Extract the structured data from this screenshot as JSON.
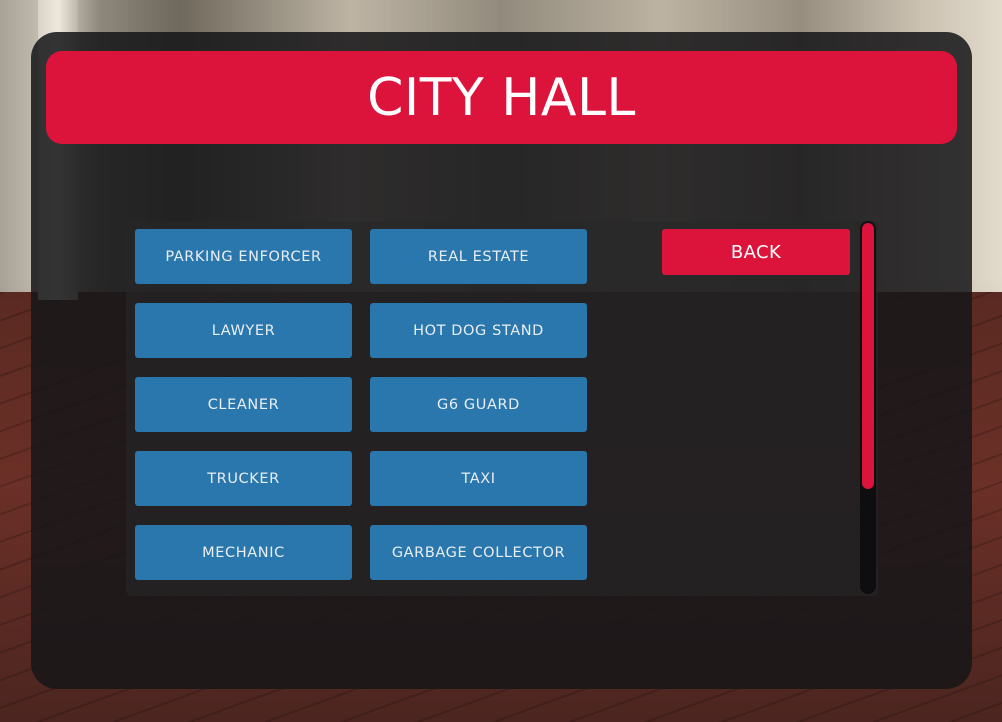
{
  "header": {
    "title": "CITY HALL"
  },
  "jobs": [
    "PARKING ENFORCER",
    "REAL ESTATE",
    "LAWYER",
    "HOT DOG STAND",
    "CLEANER",
    "G6 GUARD",
    "TRUCKER",
    "TAXI",
    "MECHANIC",
    "GARBAGE COLLECTOR"
  ],
  "back_label": "BACK",
  "scroll": {
    "thumb_fraction": 0.72
  },
  "colors": {
    "accent": "#dc143c",
    "job_button": "#2a77ad",
    "panel": "#161618"
  }
}
